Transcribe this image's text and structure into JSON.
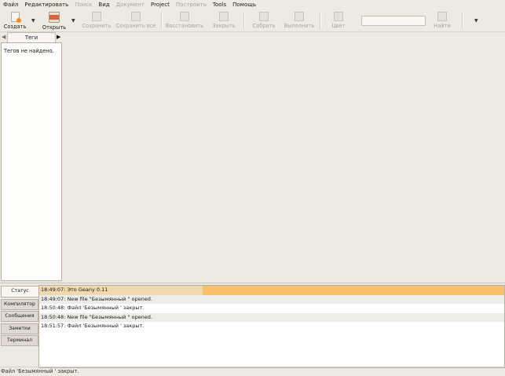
{
  "menubar": {
    "items": [
      {
        "label": "Файл",
        "enabled": true
      },
      {
        "label": "Редактировать",
        "enabled": true
      },
      {
        "label": "Поиск",
        "enabled": false
      },
      {
        "label": "Вид",
        "enabled": true
      },
      {
        "label": "Документ",
        "enabled": false
      },
      {
        "label": "Project",
        "enabled": true
      },
      {
        "label": "Построить",
        "enabled": false
      },
      {
        "label": "Tools",
        "enabled": true
      },
      {
        "label": "Помощь",
        "enabled": true
      }
    ]
  },
  "toolbar": {
    "new_label": "Создать",
    "open_label": "Открыть",
    "save_label": "Сохранить",
    "save_all_label": "Сохранить все",
    "revert_label": "Восстановить",
    "close_label": "Закрыть",
    "build_label": "Собрать",
    "run_label": "Выполнить",
    "color_label": "Цвет",
    "search_value": "",
    "find_label": "Найти"
  },
  "sidebar": {
    "tab_label": "Теги",
    "empty_message": "Тегов не найдено."
  },
  "messages": {
    "tabs": [
      "Статус",
      "Компилятор",
      "Сообщения",
      "Заметки",
      "Терминал"
    ],
    "log": [
      "18:49:07: Это Geany 0.11",
      "18:49:07: New file \"Безымянный \" opened.",
      "18:50:48: Файл 'Безымянный ' закрыт.",
      "18:50:48: New file \"Безымянный \" opened.",
      "18:51:57: Файл 'Безымянный ' закрыт."
    ]
  },
  "statusbar": {
    "text": "Файл 'Безымянный ' закрыт."
  }
}
